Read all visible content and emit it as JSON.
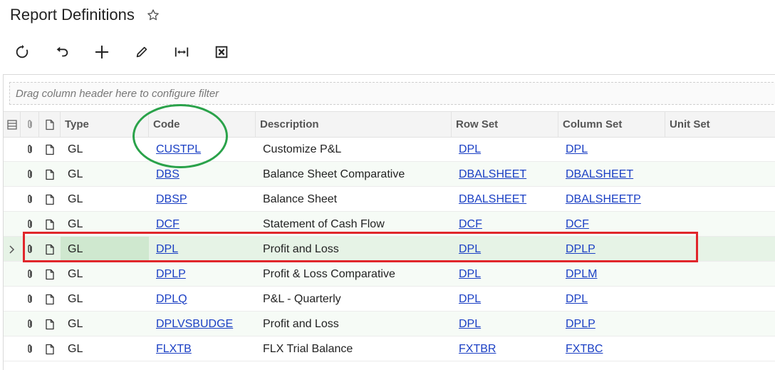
{
  "page": {
    "title": "Report Definitions"
  },
  "filter": {
    "placeholder": "Drag column header here to configure filter"
  },
  "columns": {
    "type": "Type",
    "code": "Code",
    "description": "Description",
    "row_set": "Row Set",
    "column_set": "Column Set",
    "unit_set": "Unit Set"
  },
  "rows": [
    {
      "type": "GL",
      "code": "CUSTPL",
      "description": "Customize P&L",
      "row_set": "DPL",
      "column_set": "DPL",
      "unit_set": ""
    },
    {
      "type": "GL",
      "code": "DBS",
      "description": "Balance Sheet Comparative",
      "row_set": "DBALSHEET",
      "column_set": "DBALSHEET",
      "unit_set": ""
    },
    {
      "type": "GL",
      "code": "DBSP",
      "description": "Balance Sheet",
      "row_set": "DBALSHEET",
      "column_set": "DBALSHEETP",
      "unit_set": ""
    },
    {
      "type": "GL",
      "code": "DCF",
      "description": "Statement of Cash Flow",
      "row_set": "DCF",
      "column_set": "DCF",
      "unit_set": ""
    },
    {
      "type": "GL",
      "code": "DPL",
      "description": "Profit and Loss",
      "row_set": "DPL",
      "column_set": "DPLP",
      "unit_set": ""
    },
    {
      "type": "GL",
      "code": "DPLP",
      "description": "Profit & Loss Comparative",
      "row_set": "DPL",
      "column_set": "DPLM",
      "unit_set": ""
    },
    {
      "type": "GL",
      "code": "DPLQ",
      "description": "P&L - Quarterly",
      "row_set": "DPL",
      "column_set": "DPL",
      "unit_set": ""
    },
    {
      "type": "GL",
      "code": "DPLVSBUDGE",
      "description": "Profit and Loss",
      "row_set": "DPL",
      "column_set": "DPLP",
      "unit_set": ""
    },
    {
      "type": "GL",
      "code": "FLXTB",
      "description": "FLX Trial Balance",
      "row_set": "FXTBR",
      "column_set": "FXTBC",
      "unit_set": ""
    }
  ],
  "selected_row_index": 4,
  "colors": {
    "link": "#1a3fc4",
    "selection": "#e6f3e6",
    "annotation_green": "#2aa24a",
    "annotation_red": "#e0262b"
  },
  "icons": {
    "toolbar": [
      "refresh-icon",
      "undo-icon",
      "add-icon",
      "edit-icon",
      "fit-columns-icon",
      "export-excel-icon"
    ],
    "row": [
      "attachment-icon",
      "note-icon"
    ]
  }
}
